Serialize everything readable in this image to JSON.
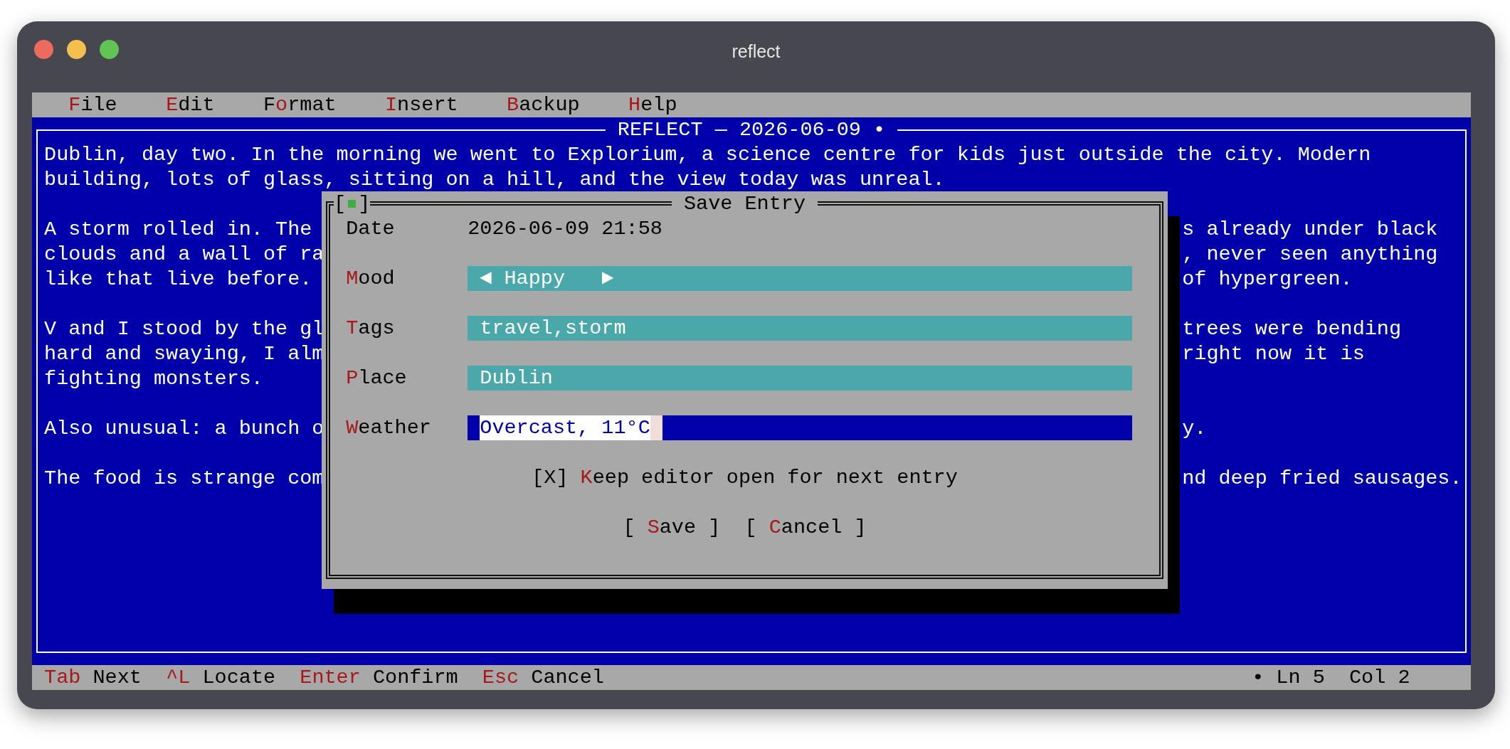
{
  "window": {
    "title": "reflect"
  },
  "menu": [
    {
      "key": "F",
      "rest": "ile"
    },
    {
      "key": "E",
      "rest": "dit"
    },
    {
      "pre": "F",
      "key": "o",
      "rest": "rmat"
    },
    {
      "key": "I",
      "rest": "nsert"
    },
    {
      "key": "B",
      "rest": "ackup"
    },
    {
      "key": "H",
      "rest": "elp"
    }
  ],
  "editor": {
    "title": "REFLECT — 2026-06-09 •",
    "lines": [
      {
        "kind": "full",
        "text": "Dublin, day two. In the morning we went to Explorium, a science centre for kids just outside the city. Modern"
      },
      {
        "kind": "full",
        "text": "building, lots of glass, sitting on a hill, and the view today was unreal."
      },
      {
        "kind": "blank"
      },
      {
        "kind": "split",
        "left": "A storm rolled in. The",
        "right": "s already under black"
      },
      {
        "kind": "split",
        "left": "clouds and a wall of ra",
        "right": ", never seen anything"
      },
      {
        "kind": "split",
        "left": "like that live before.",
        "right": "of hypergreen."
      },
      {
        "kind": "blank"
      },
      {
        "kind": "split",
        "left": "V and I stood by the gl",
        "right": "trees were bending"
      },
      {
        "kind": "split",
        "left": "hard and swaying, I alm",
        "right": "right now it is"
      },
      {
        "kind": "full",
        "text": "fighting monsters."
      },
      {
        "kind": "blank"
      },
      {
        "kind": "split",
        "left": "Also unusual: a bunch o",
        "right": "y."
      },
      {
        "kind": "blank"
      },
      {
        "kind": "split",
        "left": "The food is strange com",
        "right": "nd deep fried sausages."
      }
    ]
  },
  "dialog": {
    "title": "Save Entry",
    "close_box": {
      "open": "[",
      "close": "]"
    },
    "date": {
      "label": "Date",
      "value": "2026-06-09 21:58"
    },
    "fields": [
      {
        "kind": "choice",
        "label": {
          "key": "M",
          "rest": "ood"
        },
        "prev": "◄",
        "value": "Happy",
        "next": "►",
        "focused": false
      },
      {
        "kind": "text",
        "label": {
          "key": "T",
          "rest": "ags"
        },
        "value": "travel,storm",
        "focused": false
      },
      {
        "kind": "text",
        "label": {
          "key": "P",
          "rest": "lace"
        },
        "value": "Dublin",
        "focused": false
      },
      {
        "kind": "text",
        "label": {
          "key": "W",
          "rest": "eather"
        },
        "value": "Overcast, 11°C",
        "focused": true
      }
    ],
    "checkbox": {
      "open": "[",
      "mark": "X",
      "close": "]",
      "checked": true,
      "label": {
        "key": "K",
        "rest": "eep editor open for next entry"
      }
    },
    "buttons": [
      {
        "open": "[",
        "label": {
          "key": "S",
          "rest": "ave"
        },
        "close": "]"
      },
      {
        "open": "[",
        "label": {
          "key": "C",
          "rest": "ancel"
        },
        "close": "]"
      }
    ]
  },
  "status_bar": {
    "hints": [
      {
        "key": "Tab",
        "label": "Next"
      },
      {
        "key": "^L",
        "label": "Locate"
      },
      {
        "key": "Enter",
        "label": "Confirm"
      },
      {
        "key": "Esc",
        "label": "Cancel"
      }
    ],
    "position": "• Ln 5  Col 2"
  }
}
